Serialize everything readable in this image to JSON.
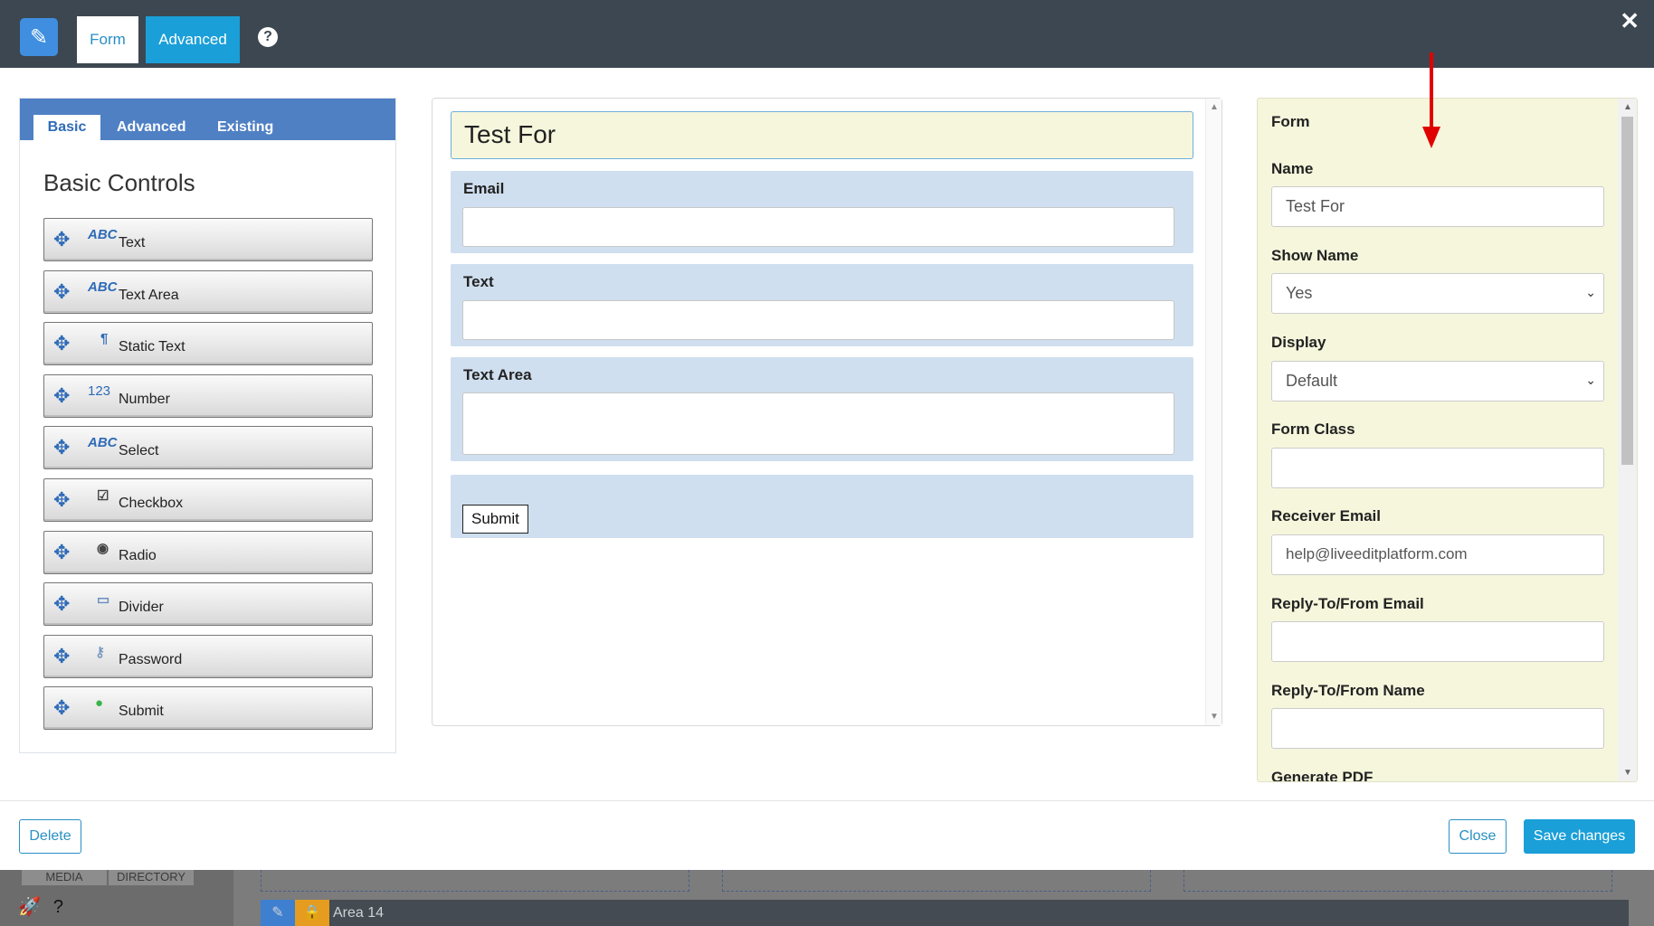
{
  "header": {
    "tabs": [
      {
        "label": "Form",
        "active": true
      },
      {
        "label": "Advanced",
        "active": false
      }
    ],
    "help_icon": "?",
    "close_icon": "✕"
  },
  "left_panel": {
    "tabs": [
      "Basic",
      "Advanced",
      "Existing"
    ],
    "title": "Basic Controls",
    "controls": [
      {
        "icon": "ABC",
        "label": "Text"
      },
      {
        "icon": "ABC",
        "label": "Text Area"
      },
      {
        "icon": "¶",
        "label": "Static Text"
      },
      {
        "icon": "123",
        "label": "Number"
      },
      {
        "icon": "ABC",
        "label": "Select"
      },
      {
        "icon": "☑",
        "label": "Checkbox"
      },
      {
        "icon": "◉",
        "label": "Radio"
      },
      {
        "icon": "▭",
        "label": "Divider"
      },
      {
        "icon": "⚷",
        "label": "Password"
      },
      {
        "icon": "●",
        "label": "Submit"
      }
    ]
  },
  "center_panel": {
    "form_title": "Test For",
    "fields": [
      {
        "label": "Email"
      },
      {
        "label": "Text"
      },
      {
        "label": "Text Area"
      }
    ],
    "submit_label": "Submit"
  },
  "right_panel": {
    "section_title": "Form",
    "name_label": "Name",
    "name_value": "Test For",
    "show_name_label": "Show Name",
    "show_name_value": "Yes",
    "display_label": "Display",
    "display_value": "Default",
    "form_class_label": "Form Class",
    "form_class_value": "",
    "receiver_email_label": "Receiver Email",
    "receiver_email_value": "help@liveeditplatform.com",
    "reply_to_email_label": "Reply-To/From Email",
    "reply_to_email_value": "",
    "reply_to_name_label": "Reply-To/From Name",
    "reply_to_name_value": "",
    "generate_pdf_label": "Generate PDF"
  },
  "footer": {
    "delete_label": "Delete",
    "close_label": "Close",
    "save_label": "Save changes"
  },
  "background": {
    "tabs": [
      "MEDIA",
      "DIRECTORY"
    ],
    "area_label": "Area 14"
  },
  "colors": {
    "header_bg": "#3c4751",
    "accent": "#1a9fd8",
    "panel_blue": "#4f80c4",
    "field_bg": "#cfdfef",
    "props_bg": "#f6f6dd",
    "annotation_arrow": "#e00000"
  }
}
